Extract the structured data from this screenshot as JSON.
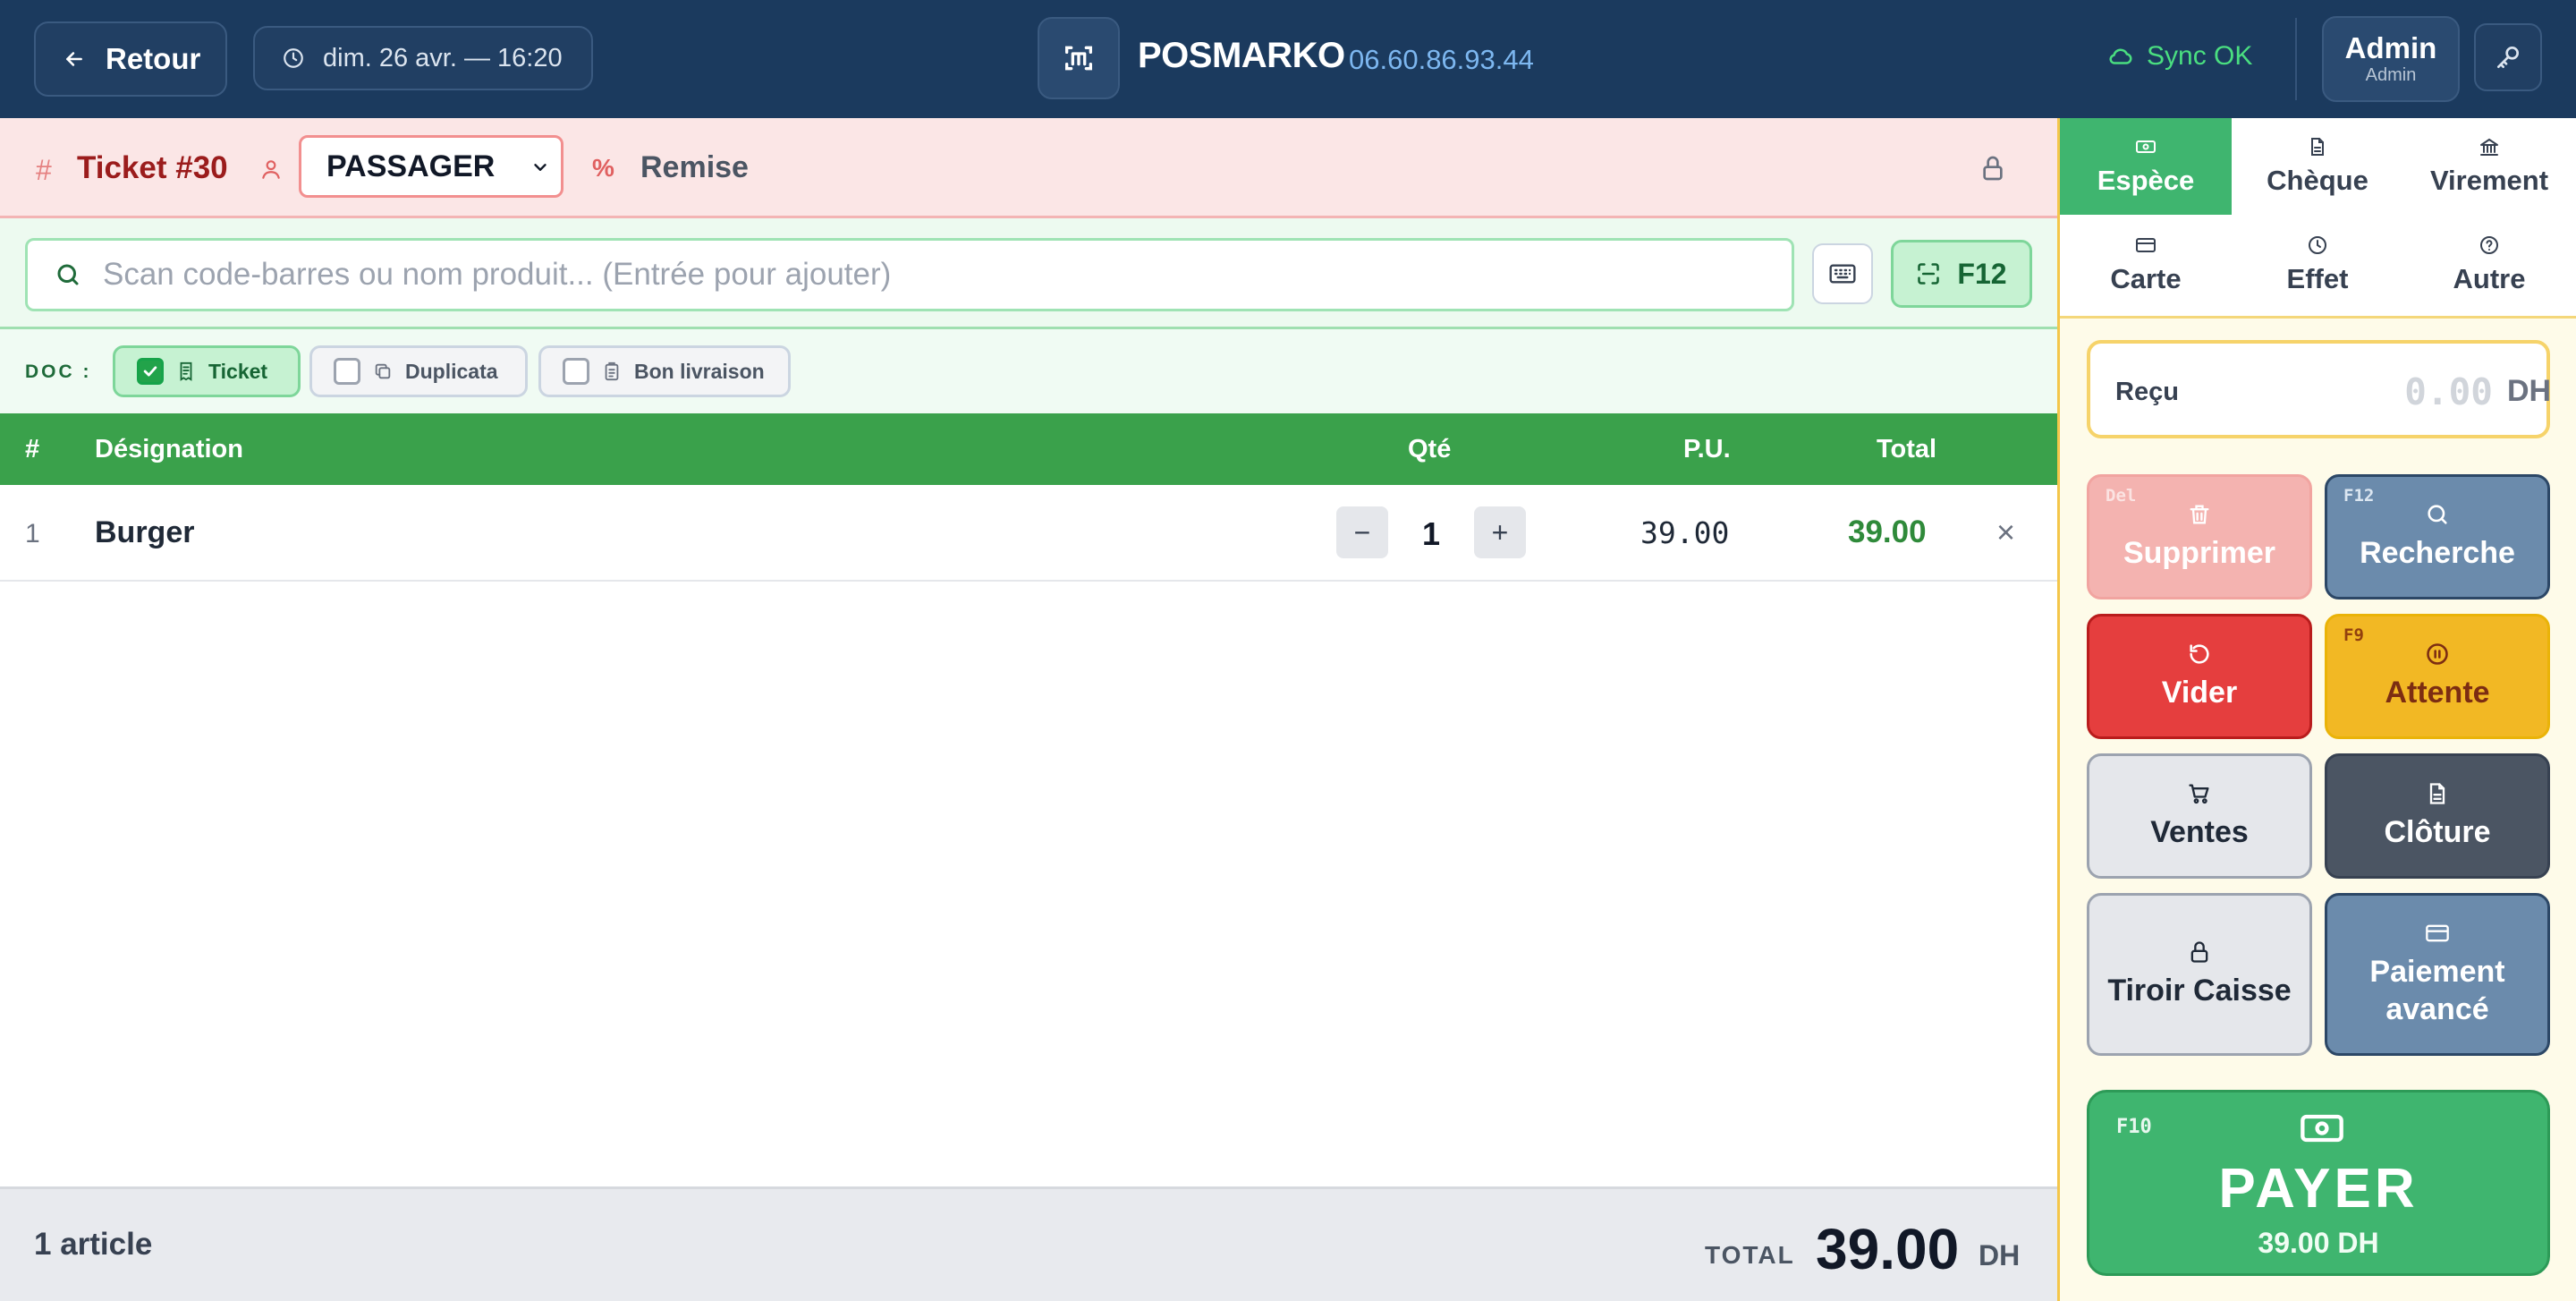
{
  "header": {
    "back_label": "Retour",
    "datetime": "dim. 26 avr. — 16:20",
    "brand": "POSMARKO",
    "phone": "06.60.86.93.44",
    "sync": "Sync OK",
    "user_name": "Admin",
    "user_role": "Admin"
  },
  "ticket": {
    "title": "Ticket #30",
    "hash": "#",
    "client": "PASSAGER",
    "discount_symbol": "%",
    "discount_label": "Remise"
  },
  "search": {
    "placeholder": "Scan code-barres ou nom produit... (Entrée pour ajouter)",
    "value": "",
    "scan_key": "F12"
  },
  "doc": {
    "label": "DOC :",
    "options": [
      {
        "label": "Ticket",
        "checked": true,
        "icon": "receipt-icon"
      },
      {
        "label": "Duplicata",
        "checked": false,
        "icon": "copy-icon"
      },
      {
        "label": "Bon livraison",
        "checked": false,
        "icon": "clipboard-icon"
      }
    ]
  },
  "table": {
    "headers": [
      "#",
      "Désignation",
      "Qté",
      "P.U.",
      "Total"
    ],
    "rows": [
      {
        "num": "1",
        "designation": "Burger",
        "qty": "1",
        "pu": "39.00",
        "total": "39.00"
      }
    ],
    "minus": "−",
    "plus": "+",
    "remove": "×"
  },
  "footer": {
    "count": "1 article",
    "total_label": "TOTAL",
    "total_value": "39.00",
    "currency": "DH"
  },
  "payment": {
    "methods": [
      {
        "label": "Espèce",
        "icon": "banknote-icon",
        "active": true
      },
      {
        "label": "Chèque",
        "icon": "document-icon",
        "active": false
      },
      {
        "label": "Virement",
        "icon": "bank-icon",
        "active": false
      },
      {
        "label": "Carte",
        "icon": "card-icon",
        "active": false
      },
      {
        "label": "Effet",
        "icon": "clock-icon",
        "active": false
      },
      {
        "label": "Autre",
        "icon": "question-icon",
        "active": false
      }
    ],
    "received_label": "Reçu",
    "received_value": "0.00",
    "received_currency": "DH"
  },
  "actions": {
    "delete": {
      "key": "Del",
      "label": "Supprimer"
    },
    "search": {
      "key": "F12",
      "label": "Recherche"
    },
    "clear": {
      "label": "Vider"
    },
    "hold": {
      "key": "F9",
      "label": "Attente"
    },
    "sales": {
      "label": "Ventes"
    },
    "closing": {
      "label": "Clôture"
    },
    "drawer": {
      "label": "Tiroir Caisse"
    },
    "advanced": {
      "label": "Paiement avancé"
    }
  },
  "pay": {
    "key": "F10",
    "label": "PAYER",
    "amount": "39.00 DH"
  },
  "colors": {
    "header_bg": "#1b3a5e",
    "accent_green": "#3aa14b",
    "pay_green": "#3fb56f",
    "ticket_red": "#9b1c1c",
    "hold_yellow": "#f2b824",
    "clear_red": "#e53e3e"
  }
}
